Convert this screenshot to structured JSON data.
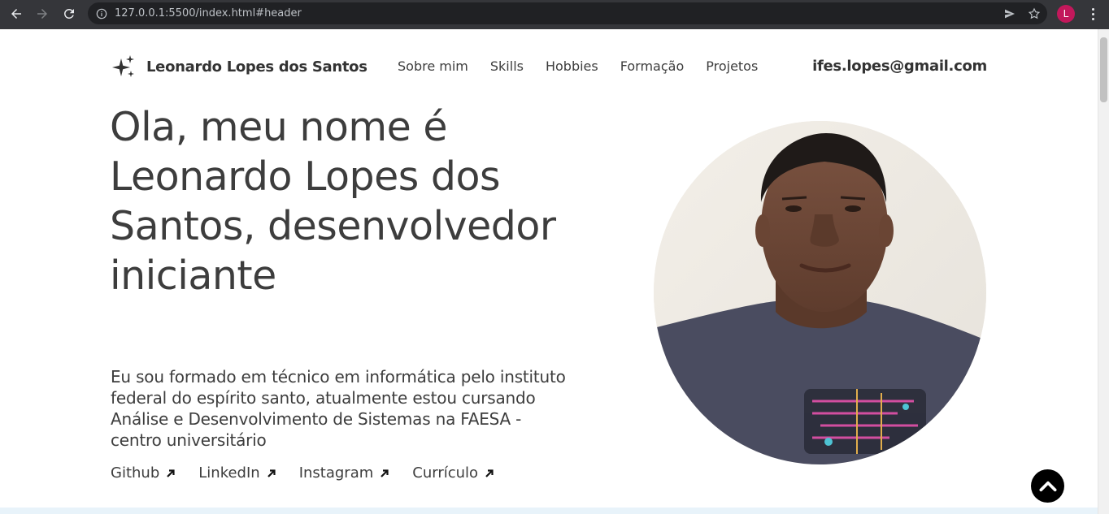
{
  "browser": {
    "url": "127.0.0.1:5500/index.html#header",
    "profile_initial": "L",
    "accent_profile": "#c2185b"
  },
  "header": {
    "brand_name": "Leonardo Lopes dos Santos",
    "brand_icon": "sparkles-icon",
    "nav": [
      {
        "label": "Sobre mim"
      },
      {
        "label": "Skills"
      },
      {
        "label": "Hobbies"
      },
      {
        "label": "Formação"
      },
      {
        "label": "Projetos"
      }
    ],
    "email": "ifes.lopes@gmail.com"
  },
  "hero": {
    "title": "Ola, meu nome é Leonardo Lopes dos Santos, desenvolvedor iniciante",
    "description": "Eu sou formado em técnico em informática pelo instituto federal do espírito santo, atualmente estou cursando Análise e Desenvolvimento de Sistemas na FAESA - centro universitário",
    "links": [
      {
        "label": "Github"
      },
      {
        "label": "LinkedIn"
      },
      {
        "label": "Instagram"
      },
      {
        "label": "Currículo"
      }
    ]
  }
}
